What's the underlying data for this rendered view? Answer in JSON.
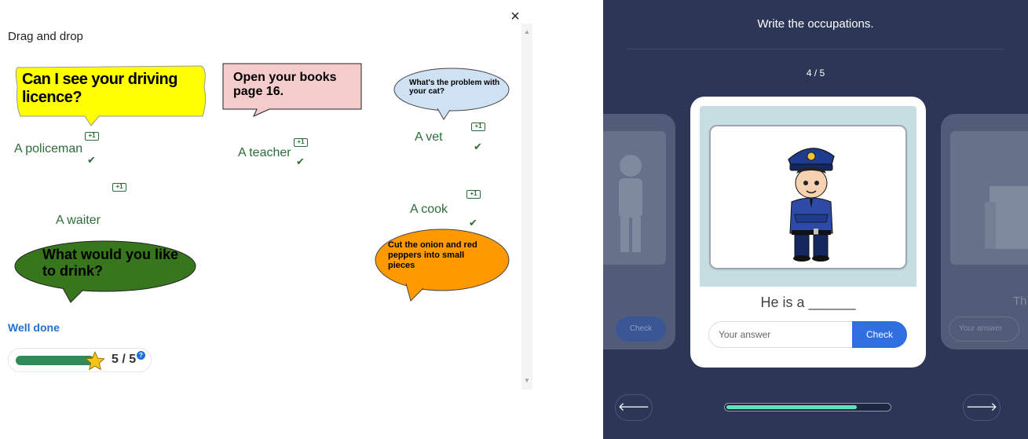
{
  "left_panel": {
    "title": "Drag and drop",
    "close_label": "×",
    "bubbles": [
      {
        "text": "Can I see your driving licence?",
        "color": "#ffff00"
      },
      {
        "text": "Open your books page 16.",
        "color": "#f4cccc"
      },
      {
        "text": "What's the problem with your cat?",
        "color": "#cfe2f3"
      },
      {
        "text": "What would you like to drink?",
        "color": "#38761d"
      },
      {
        "text": "Cut the onion and red peppers into small pieces",
        "color": "#ff9900"
      }
    ],
    "answers": [
      {
        "label": "A policeman",
        "badge": "+1"
      },
      {
        "label": "A teacher",
        "badge": "+1"
      },
      {
        "label": "A vet",
        "badge": "+1"
      },
      {
        "label": "A waiter",
        "badge": "+1"
      },
      {
        "label": "A cook",
        "badge": "+1"
      }
    ],
    "feedback": "Well done",
    "score": "5 / 5",
    "score_fraction": 1.0,
    "help_icon": "?",
    "star_color": "#f5c518",
    "accent_green": "#2e6b3a"
  },
  "right_panel": {
    "title": "Write the occupations.",
    "counter": "4 / 5",
    "sentence": "He is a ______",
    "answer_placeholder": "Your answer",
    "check_label": "Check",
    "side_check_label": "Check",
    "side_right_text": "Th",
    "side_right_placeholder": "Your answer",
    "progress_fraction": 0.8,
    "bg_color": "#2c3757",
    "accent_blue": "#2f6fe0",
    "progress_color": "#5fe3b8",
    "icons": {
      "prev": "arrow-left-icon",
      "next": "arrow-right-icon"
    }
  }
}
